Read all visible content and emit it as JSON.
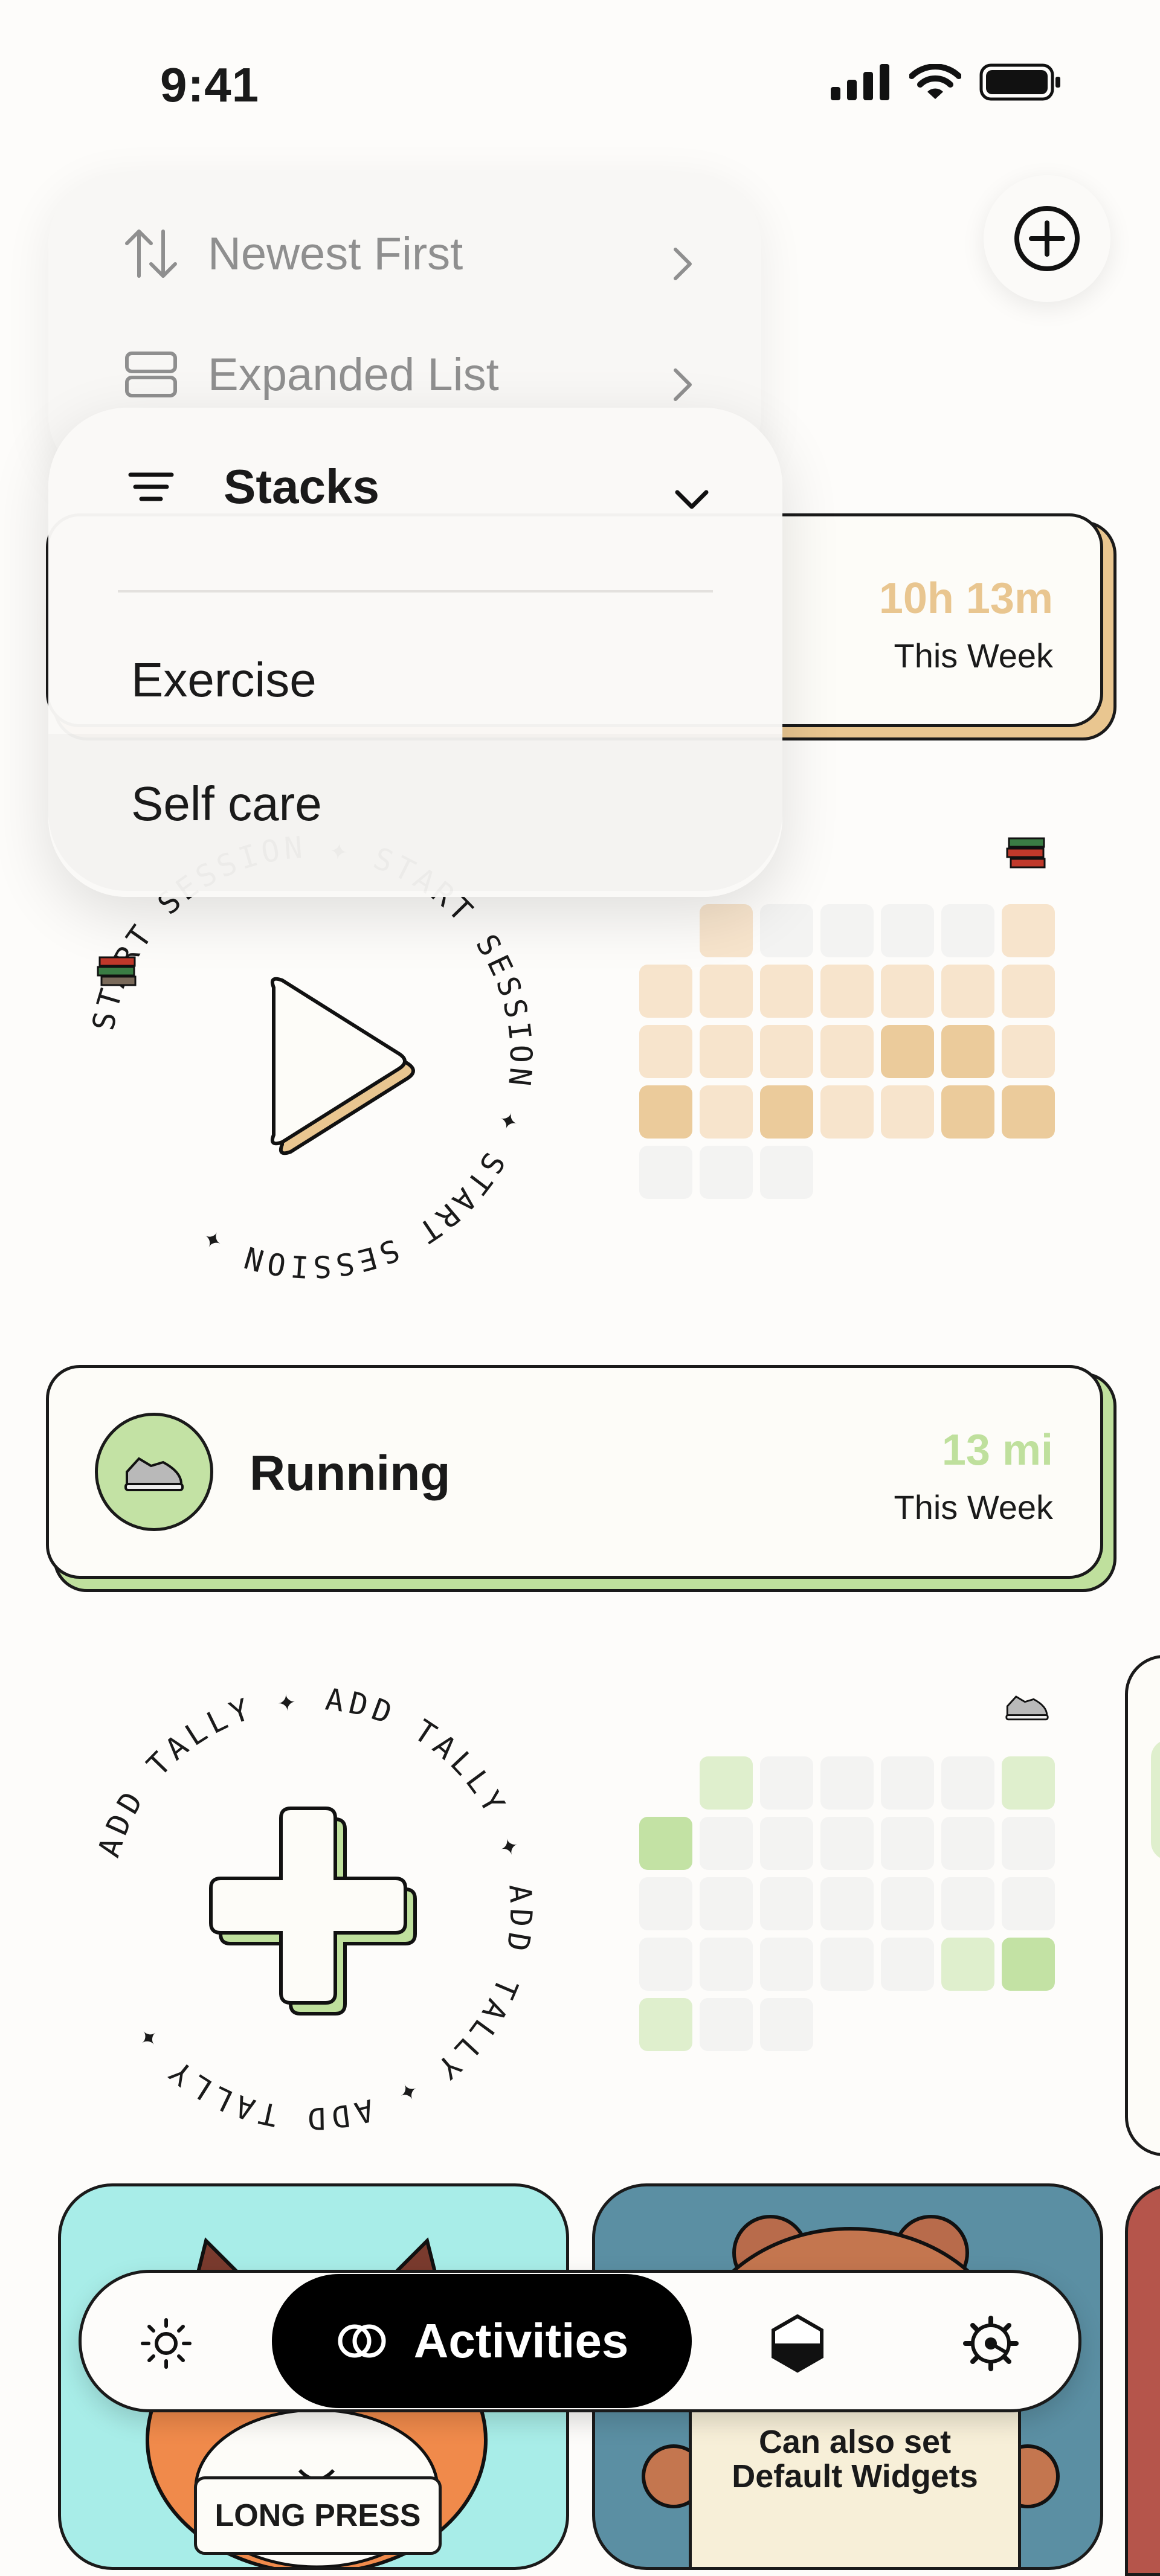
{
  "status_bar": {
    "time": "9:41"
  },
  "sort_menu": {
    "items": [
      {
        "label": "Newest First",
        "icon": "sort-arrows-icon"
      },
      {
        "label": "Expanded List",
        "icon": "list-layout-icon"
      }
    ]
  },
  "stacks_menu": {
    "title": "Stacks",
    "options": [
      "Exercise",
      "Self care"
    ]
  },
  "reading_card": {
    "value": "10h 13m",
    "period": "This Week",
    "accent": "#e9c690",
    "ring_text": "START SESSION"
  },
  "running_card": {
    "title": "Running",
    "value": "13 mi",
    "period": "This Week",
    "accent": "#bfe09d",
    "ring_text": "ADD TALLY"
  },
  "heatmap_reading": {
    "levels": [
      [
        null,
        1,
        0,
        0,
        0,
        0,
        1
      ],
      [
        1,
        1,
        1,
        1,
        1,
        1,
        1
      ],
      [
        1,
        1,
        1,
        1,
        2,
        2,
        1
      ],
      [
        2,
        1,
        2,
        1,
        1,
        2,
        2
      ],
      [
        0,
        0,
        0,
        null,
        null,
        null,
        null
      ]
    ],
    "colors": [
      "#f3f3f2",
      "#f7e4cc",
      "#ebcb9b"
    ]
  },
  "heatmap_running": {
    "levels": [
      [
        null,
        1,
        0,
        0,
        0,
        0,
        1
      ],
      [
        2,
        0,
        0,
        0,
        0,
        0,
        0
      ],
      [
        0,
        0,
        0,
        0,
        0,
        0,
        0
      ],
      [
        0,
        0,
        0,
        0,
        0,
        1,
        2
      ],
      [
        1,
        0,
        0,
        null,
        null,
        null,
        null
      ]
    ],
    "colors": [
      "#f3f3f2",
      "#dfefcd",
      "#c3e2a4"
    ]
  },
  "widgets": [
    {
      "text": "LONG PRESS",
      "bg": "#a8ede8",
      "icon": "fox-illustration"
    },
    {
      "text": "Can also set Default Widgets",
      "bg": "#5b8fa3",
      "icon": "bear-illustration"
    }
  ],
  "tab_bar": {
    "active_label": "Activities",
    "tabs": [
      "sun-icon",
      "activities-icon",
      "stack-icon",
      "gear-icon"
    ]
  }
}
